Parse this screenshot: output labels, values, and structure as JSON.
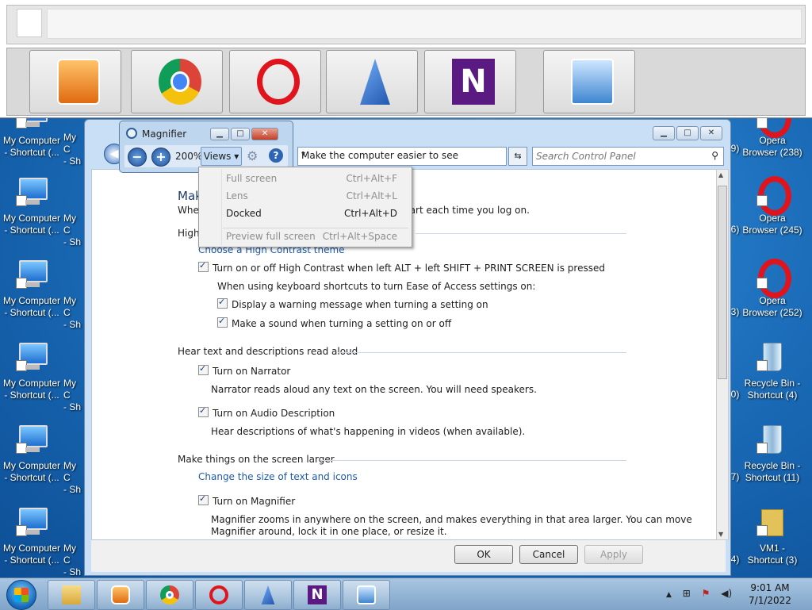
{
  "desktop": {
    "left_icons": [
      {
        "label1": "My Computer",
        "label2": "- Shortcut (..."
      },
      {
        "label1": "My Computer",
        "label2": "- Shortcut (..."
      },
      {
        "label1": "My Computer",
        "label2": "- Shortcut (..."
      },
      {
        "label1": "My Computer",
        "label2": "- Shortcut (..."
      },
      {
        "label1": "My Computer",
        "label2": "- Shortcut (..."
      },
      {
        "label1": "My Computer",
        "label2": "- Shortcut (..."
      }
    ],
    "second_col_label1": "My C",
    "second_col_label2": "- Sh",
    "right_icons": [
      {
        "label1": "Opera",
        "label2": "Browser (238)",
        "prefix": "9)"
      },
      {
        "label1": "Opera",
        "label2": "Browser (245)",
        "prefix": "6)"
      },
      {
        "label1": "Opera",
        "label2": "Browser (252)",
        "prefix": "3)"
      },
      {
        "label1": "Recycle Bin -",
        "label2": "Shortcut (4)",
        "prefix": "0)"
      },
      {
        "label1": "Recycle Bin -",
        "label2": "Shortcut (11)",
        "prefix": "7)"
      },
      {
        "label1": "VM1 -",
        "label2": "Shortcut (3)",
        "prefix": "4)"
      }
    ]
  },
  "control_panel": {
    "address": "Make the computer easier to see",
    "search_placeholder": "Search Control Panel",
    "title_partial": "Mak",
    "intro_left": "When",
    "intro_right": "tart each time you log on.",
    "high_contrast_heading": "High",
    "choose_theme_link": "Choose a High Contrast theme",
    "hc_toggle": "Turn on or off High Contrast when left ALT + left SHIFT + PRINT SCREEN is pressed",
    "shortcuts_note": "When using keyboard shortcuts to turn Ease of Access settings on:",
    "warning_msg": "Display a warning message when turning a setting on",
    "sound_msg": "Make a sound when turning a setting on or off",
    "hear_heading": "Hear text and descriptions read aloud",
    "narrator": "Turn on Narrator",
    "narrator_desc": "Narrator reads aloud any text on the screen. You will need speakers.",
    "audio_desc": "Turn on Audio Description",
    "audio_desc_desc": "Hear descriptions of what's happening in videos (when available).",
    "larger_heading": "Make things on the screen larger",
    "change_size_link": "Change the size of text and icons",
    "magnifier_toggle": "Turn on Magnifier",
    "magnifier_desc1": "Magnifier zooms in anywhere on the screen, and makes everything in that area larger. You can move",
    "magnifier_desc2": "Magnifier around, lock it in one place, or resize it.",
    "ok": "OK",
    "cancel": "Cancel",
    "apply": "Apply"
  },
  "magnifier": {
    "title": "Magnifier",
    "zoom": "200%",
    "views": "Views",
    "views_arrow": "▾",
    "menu": [
      {
        "label": "Full screen",
        "shortcut": "Ctrl+Alt+F",
        "enabled": false
      },
      {
        "label": "Lens",
        "shortcut": "Ctrl+Alt+L",
        "enabled": false
      },
      {
        "label": "Docked",
        "shortcut": "Ctrl+Alt+D",
        "enabled": true
      },
      {
        "label": "Preview full screen",
        "shortcut": "Ctrl+Alt+Space",
        "enabled": false
      }
    ]
  },
  "taskbar": {
    "time": "9:01 AM",
    "date": "7/1/2022"
  },
  "glyphs": {
    "minus": "−",
    "plus": "+",
    "help": "?",
    "gear": "⚙",
    "back": "◀",
    "search": "⚲",
    "dropdown": "▾",
    "refresh": "⇆",
    "minimize": "▁",
    "maximize": "□",
    "close": "✕",
    "tray_arrow": "▲",
    "tray_net": "⊞",
    "tray_flag": "⚑",
    "tray_vol": "◀)",
    "n_logo": "N"
  }
}
